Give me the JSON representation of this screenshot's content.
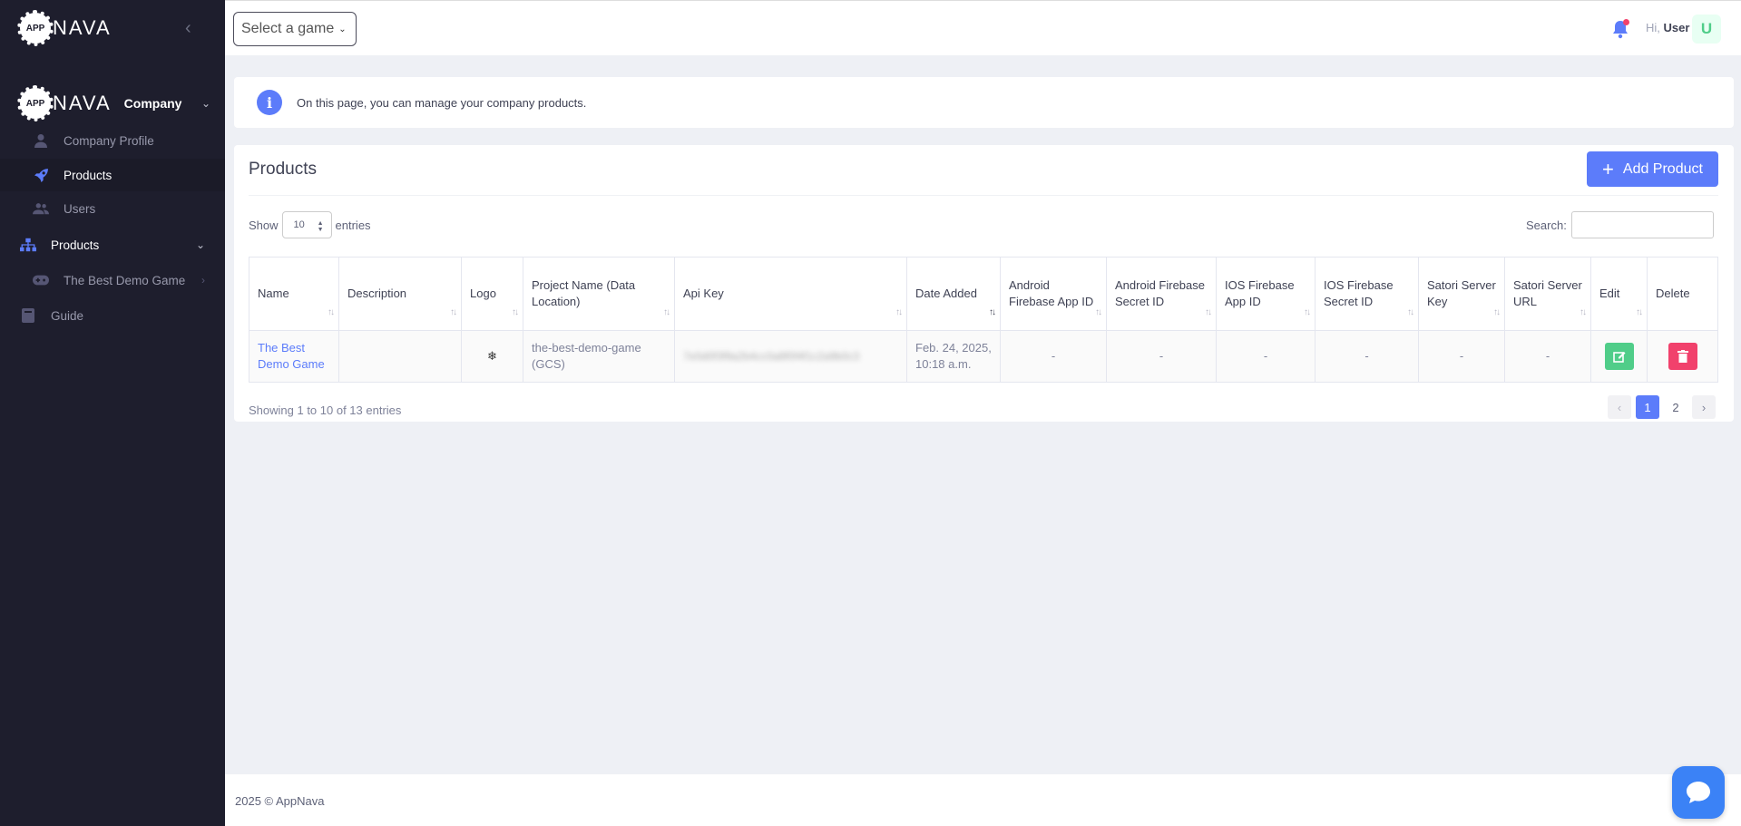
{
  "sidebar": {
    "brand": {
      "logo_badge": "APP",
      "logo_word": "NAVA"
    },
    "company_section": {
      "label": "Company",
      "badge": "APP",
      "word": "NAVA"
    },
    "company_items": [
      {
        "label": "Company Profile",
        "icon": "user-icon"
      },
      {
        "label": "Products",
        "icon": "rocket-icon",
        "active": true
      },
      {
        "label": "Users",
        "icon": "users-icon"
      }
    ],
    "products_section": {
      "label": "Products",
      "icon": "sitemap-icon"
    },
    "product_items": [
      {
        "label": "The Best Demo Game",
        "icon": "gamepad-icon"
      }
    ],
    "guide": {
      "label": "Guide",
      "icon": "book-icon"
    }
  },
  "header": {
    "game_select_placeholder": "Select a game",
    "greeting_prefix": "Hi,",
    "user_name": "User",
    "avatar_letter": "U"
  },
  "info": {
    "message": "On this page, you can manage your company products."
  },
  "products": {
    "title": "Products",
    "add_button": "Add Product",
    "show_label": "Show",
    "page_size": "10",
    "entries_label": "entries",
    "search_label": "Search:",
    "columns": [
      "Name",
      "Description",
      "Logo",
      "Project Name (Data Location)",
      "Api Key",
      "Date Added",
      "Android Firebase App ID",
      "Android Firebase Secret ID",
      "IOS Firebase App ID",
      "IOS Firebase Secret ID",
      "Satori Server Key",
      "Satori Server URL",
      "Edit",
      "Delete"
    ],
    "rows": [
      {
        "name": "The Best Demo Game",
        "description": "",
        "logo": "❄",
        "project_name": "the-best-demo-game (GCS)",
        "api_key": "7e0d0f3f9a2b4cc0a8f0f4f1c2a9b0c3",
        "date_added": "Feb. 24, 2025, 10:18 a.m.",
        "android_app_id": "-",
        "android_secret_id": "-",
        "ios_app_id": "-",
        "ios_secret_id": "-",
        "satori_key": "-",
        "satori_url": "-"
      }
    ],
    "showing_text": "Showing 1 to 10 of 13 entries",
    "pages": [
      "1",
      "2"
    ],
    "current_page": "1"
  },
  "footer": {
    "copyright": "2025 © AppNava"
  },
  "colors": {
    "accent": "#5c7cfa",
    "sidebar_bg": "#1e1e2d",
    "edit": "#50cd89",
    "delete": "#f1416c"
  }
}
